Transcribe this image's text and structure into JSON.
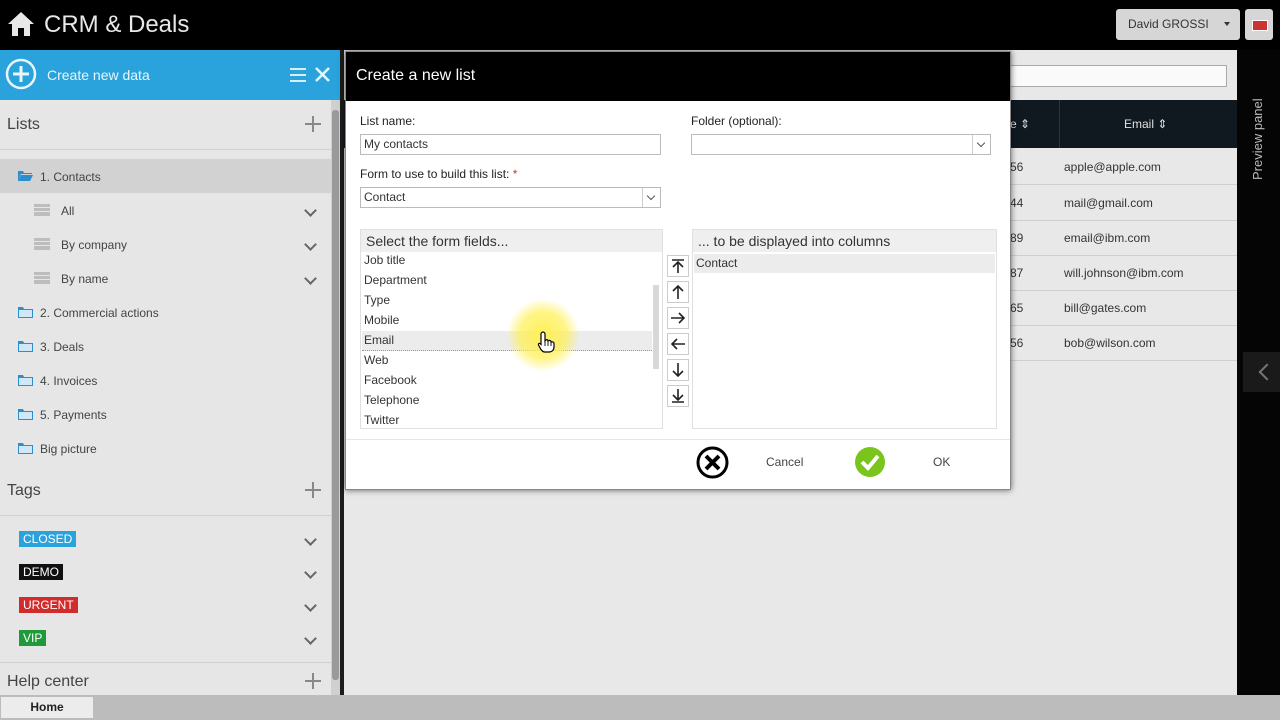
{
  "app": {
    "title": "CRM & Deals"
  },
  "user": {
    "name": "David GROSSI"
  },
  "sidebar": {
    "create_label": "Create new data",
    "lists_title": "Lists",
    "lists": [
      {
        "label": "1. Contacts"
      },
      {
        "label": "All"
      },
      {
        "label": "By company"
      },
      {
        "label": "By name"
      },
      {
        "label": "2. Commercial actions"
      },
      {
        "label": "3. Deals"
      },
      {
        "label": "4. Invoices"
      },
      {
        "label": "5. Payments"
      },
      {
        "label": "Big picture"
      }
    ],
    "tags_title": "Tags",
    "tags": [
      {
        "label": "CLOSED",
        "color": "#2aa3dc"
      },
      {
        "label": "DEMO",
        "color": "#111111"
      },
      {
        "label": "URGENT",
        "color": "#d12b2b"
      },
      {
        "label": "VIP",
        "color": "#1f9a3a"
      }
    ],
    "help_title": "Help center"
  },
  "bottom": {
    "home_tab": "Home"
  },
  "background_table": {
    "header_partial": "e",
    "email_header": "Email",
    "rows": [
      {
        "num": "56",
        "email": "apple@apple.com"
      },
      {
        "num": "44",
        "email": "mail@gmail.com"
      },
      {
        "num": "89",
        "email": "email@ibm.com"
      },
      {
        "num": "87",
        "email": "will.johnson@ibm.com"
      },
      {
        "num": "65",
        "email": "bill@gates.com"
      },
      {
        "num": "56",
        "email": "bob@wilson.com"
      }
    ]
  },
  "preview_panel": {
    "label": "Preview panel"
  },
  "modal": {
    "title": "Create a new list",
    "list_name_label": "List name:",
    "list_name_value": "My contacts",
    "folder_label": "Folder (optional):",
    "folder_value": "",
    "form_label": "Form to use to build this list:",
    "required_mark": "*",
    "form_value": "Contact",
    "available_header": "Select the form fields...",
    "available_fields": [
      "Job title",
      "Department",
      "Type",
      "Mobile",
      "Email",
      "Web",
      "Facebook",
      "Telephone",
      "Twitter"
    ],
    "selected_index": 4,
    "columns_header": "... to be displayed into columns",
    "columns": [
      "Contact"
    ],
    "cancel_label": "Cancel",
    "ok_label": "OK"
  }
}
